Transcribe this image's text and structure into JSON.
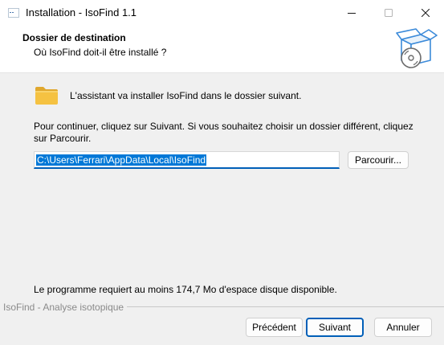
{
  "window": {
    "title": "Installation - IsoFind 1.1"
  },
  "header": {
    "title": "Dossier de destination",
    "subtitle": "Où IsoFind doit-il être installé ?"
  },
  "content": {
    "intro": "L'assistant va installer IsoFind dans le dossier suivant.",
    "continue_text": "Pour continuer, cliquez sur Suivant. Si vous souhaitez choisir un dossier différent, cliquez sur Parcourir.",
    "install_path": "C:\\Users\\Ferrari\\AppData\\Local\\IsoFind",
    "browse_label": "Parcourir...",
    "space_required": "Le programme requiert au moins 174,7 Mo d'espace disque disponible."
  },
  "footer": {
    "brand": "IsoFind - Analyse isotopique",
    "back_label": "Précédent",
    "next_label": "Suivant",
    "cancel_label": "Annuler"
  },
  "colors": {
    "accent": "#005fb8",
    "selection": "#0078d7",
    "folder": "#f5c242"
  },
  "icons": {
    "app": "installer-app-icon",
    "minimize": "minimize-icon",
    "maximize": "maximize-icon",
    "close": "close-icon",
    "header": "box-with-disc-icon",
    "folder": "folder-icon"
  }
}
